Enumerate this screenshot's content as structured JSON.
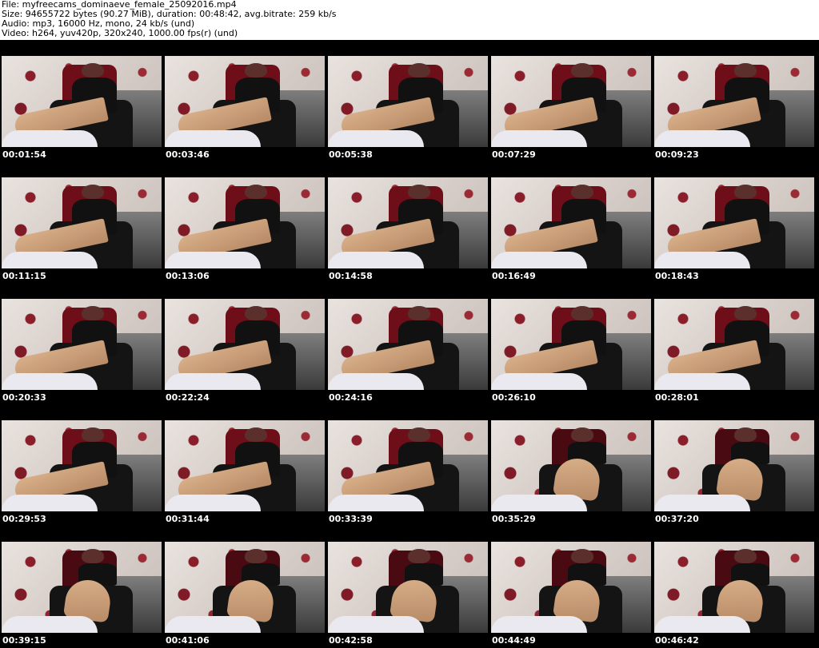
{
  "header": {
    "file": "File: myfreecams_dominaeve_female_25092016.mp4",
    "size": "Size: 94655722 bytes (90.27 MiB), duration: 00:48:42, avg.bitrate: 259 kb/s",
    "audio": "Audio: mp3, 16000 Hz, mono, 24 kb/s (und)",
    "video": "Video: h264, yuv420p, 320x240, 1000.00 fps(r) (und)"
  },
  "rows": [
    {
      "timestamps": [
        "00:01:54",
        "00:03:46",
        "00:05:38",
        "00:07:29",
        "00:09:23"
      ]
    },
    {
      "timestamps": [
        "00:11:15",
        "00:13:06",
        "00:14:58",
        "00:16:49",
        "00:18:43"
      ]
    },
    {
      "timestamps": [
        "00:20:33",
        "00:22:24",
        "00:24:16",
        "00:26:10",
        "00:28:01"
      ]
    },
    {
      "timestamps": [
        "00:29:53",
        "00:31:44",
        "00:33:39",
        "00:35:29",
        "00:37:20"
      ]
    },
    {
      "timestamps": [
        "00:39:15",
        "00:41:06",
        "00:42:58",
        "00:44:49",
        "00:46:42"
      ]
    }
  ],
  "colors": {
    "background": "#000000",
    "header_background": "#ffffff",
    "header_text": "#000000",
    "timestamp_text": "#ffffff"
  }
}
